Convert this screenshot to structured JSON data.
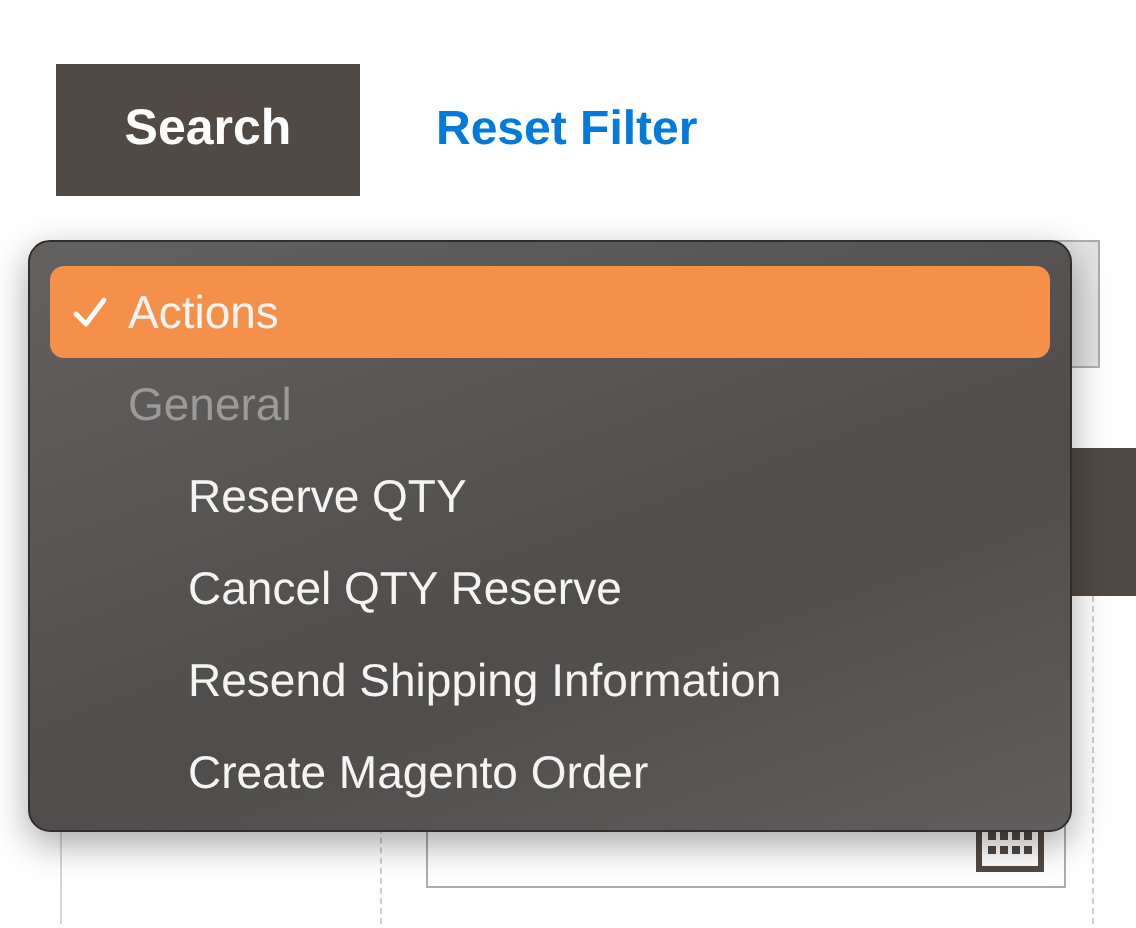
{
  "toolbar": {
    "search_button": "Search",
    "reset_link": "Reset Filter"
  },
  "dropdown": {
    "items": [
      {
        "kind": "option",
        "label": "Actions",
        "selected": true
      },
      {
        "kind": "group",
        "label": "General",
        "children": [
          {
            "label": "Reserve QTY",
            "selected": false
          },
          {
            "label": "Cancel QTY Reserve",
            "selected": false
          },
          {
            "label": "Resend Shipping Information",
            "selected": false
          },
          {
            "label": "Create Magento Order",
            "selected": false
          }
        ]
      }
    ]
  }
}
